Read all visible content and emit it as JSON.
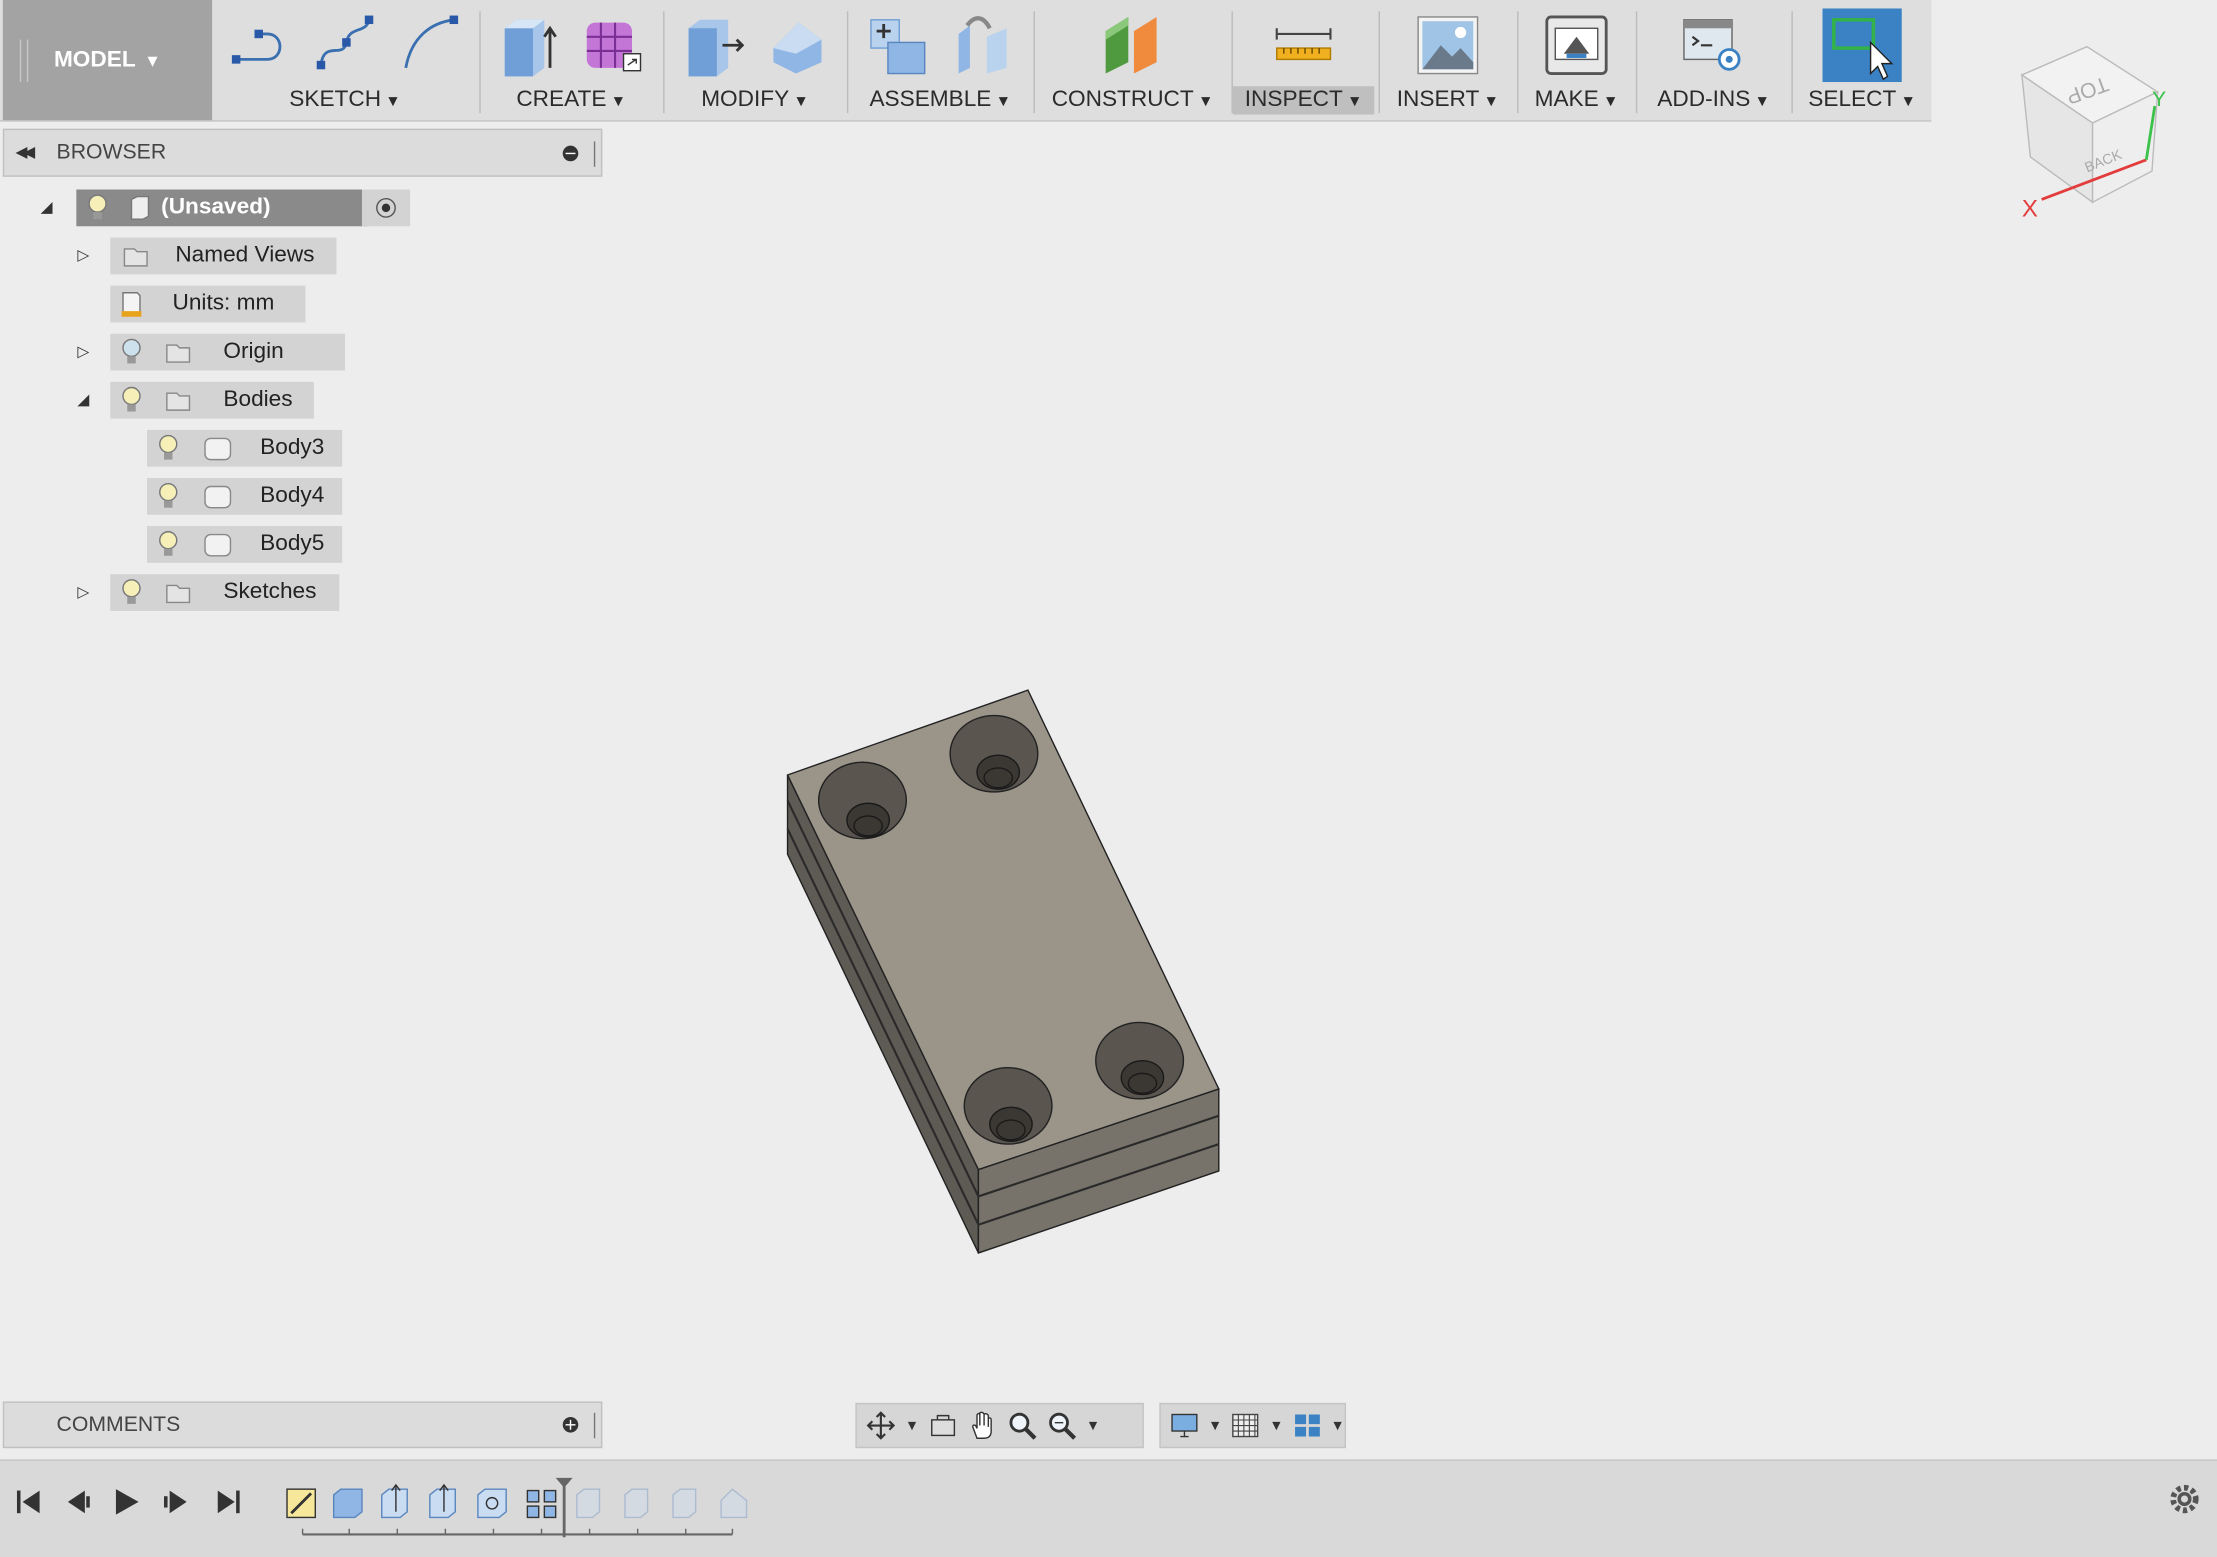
{
  "workspace": {
    "label": "MODEL"
  },
  "toolbar": {
    "groups": [
      {
        "label": "SKETCH",
        "icons": [
          "sketch-line-icon",
          "sketch-spline-icon",
          "sketch-arc-icon"
        ]
      },
      {
        "label": "CREATE",
        "icons": [
          "extrude-icon",
          "form-icon"
        ]
      },
      {
        "label": "MODIFY",
        "icons": [
          "press-pull-icon",
          "fillet-icon"
        ]
      },
      {
        "label": "ASSEMBLE",
        "icons": [
          "new-component-icon",
          "joint-icon"
        ]
      },
      {
        "label": "CONSTRUCT",
        "icons": [
          "offset-plane-icon"
        ]
      },
      {
        "label": "INSPECT",
        "icons": [
          "measure-icon"
        ]
      },
      {
        "label": "INSERT",
        "icons": [
          "insert-image-icon"
        ]
      },
      {
        "label": "MAKE",
        "icons": [
          "3d-print-icon"
        ]
      },
      {
        "label": "ADD-INS",
        "icons": [
          "scripts-icon"
        ]
      },
      {
        "label": "SELECT",
        "icons": [
          "select-icon"
        ]
      }
    ],
    "active_group": "INSPECT"
  },
  "browser": {
    "title": "BROWSER",
    "items": [
      {
        "label": "(Unsaved)"
      },
      {
        "label": "Named Views"
      },
      {
        "label": "Units: mm"
      },
      {
        "label": "Origin"
      },
      {
        "label": "Bodies"
      },
      {
        "label": "Body3"
      },
      {
        "label": "Body4"
      },
      {
        "label": "Body5"
      },
      {
        "label": "Sketches"
      }
    ]
  },
  "comments": {
    "title": "COMMENTS"
  },
  "viewcube": {
    "top_label": "TOP",
    "back_label": "BACK",
    "x_axis": "X",
    "y_axis": "Y"
  },
  "colors": {
    "toolbar_bg": "#dedede",
    "workspace_bg": "#a3a3a3",
    "select_active": "#3b82c4",
    "viewport_bg": "#ededed",
    "model_top": "#9a9489",
    "model_side": "#6d6860"
  }
}
